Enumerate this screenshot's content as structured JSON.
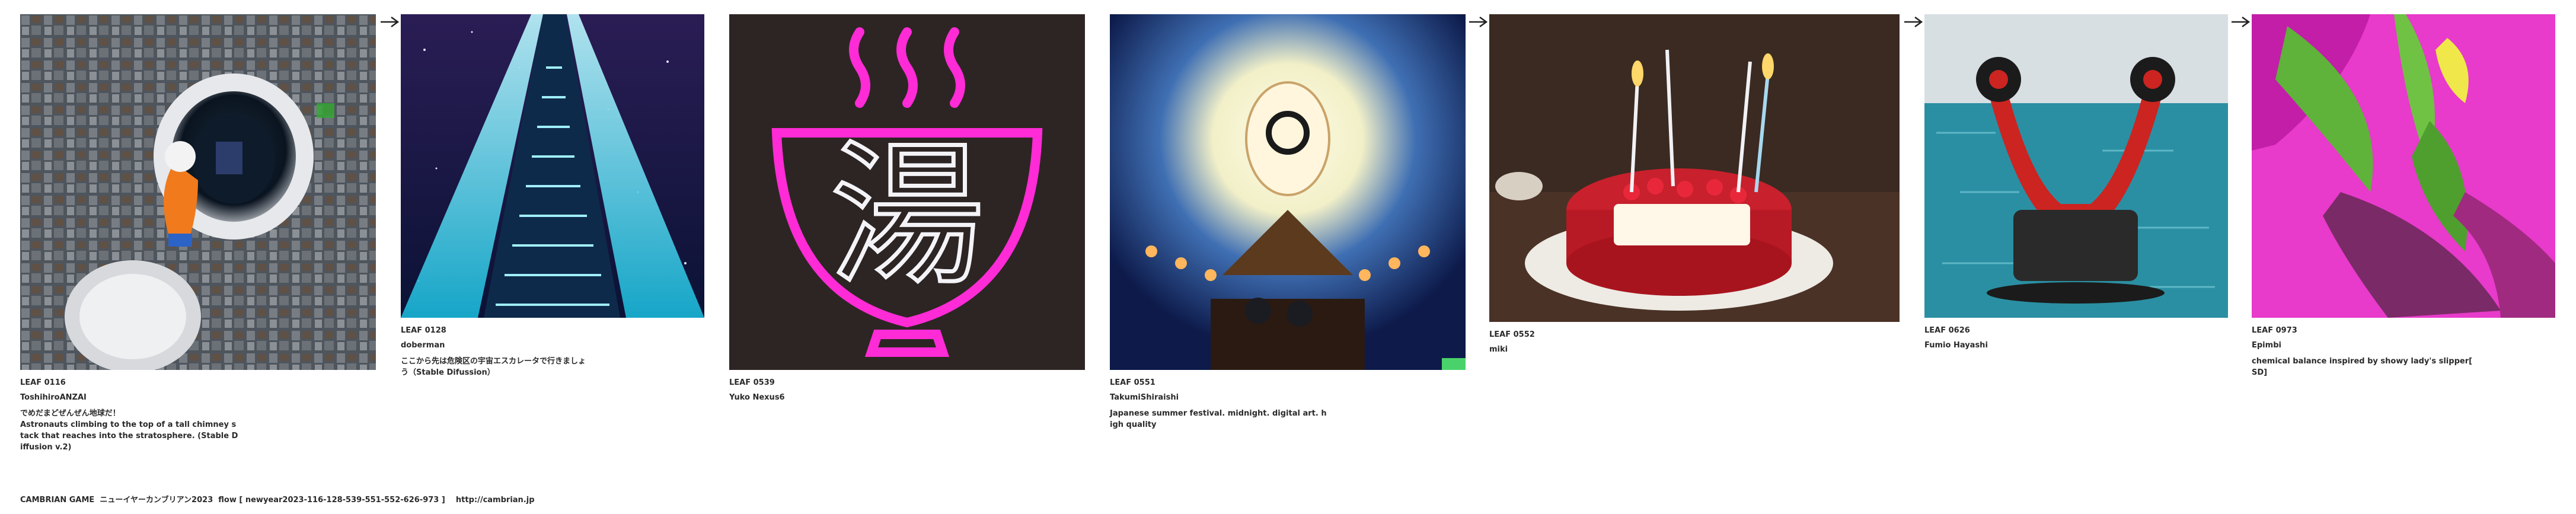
{
  "cards": [
    {
      "leaf": "LEAF 0116",
      "author": "ToshihiroANZAI",
      "desc": "でめだまどぜんぜん地球だ！\nAstronauts climbing to the top of a tall chimney s\ntack that reaches into the stratosphere. (Stable D\niffusion v.2)"
    },
    {
      "leaf": "LEAF 0128",
      "author": "doberman",
      "desc": "ここから先は危険区の宇宙エスカレータで行きましょ\nう（Stable Difussion）"
    },
    {
      "leaf": "LEAF 0539",
      "author": "Yuko Nexus6",
      "desc": "",
      "sign_text": "湯"
    },
    {
      "leaf": "LEAF 0551",
      "author": "TakumiShiraishi",
      "desc": "Japanese summer festival. midnight. digital art. h\nigh quality"
    },
    {
      "leaf": "LEAF 0552",
      "author": "miki",
      "desc": ""
    },
    {
      "leaf": "LEAF 0626",
      "author": "Fumio Hayashi",
      "desc": ""
    },
    {
      "leaf": "LEAF 0973",
      "author": "Epimbi",
      "desc": "chemical balance inspired by showy lady's slipper[\nSD]"
    }
  ],
  "footer": {
    "text": "CAMBRIAN GAME  ニューイヤーカンブリアン2023  flow [ newyear2023-116-128-539-551-552-626-973 ]    http://cambrian.jp"
  },
  "colors": {
    "neon_pink": "#ff2bd6",
    "escalator_cyan": "#35e6ff",
    "night_blue": "#0d1a4a",
    "sea": "#2a8fa3",
    "orchid_green": "#5fb23a"
  }
}
